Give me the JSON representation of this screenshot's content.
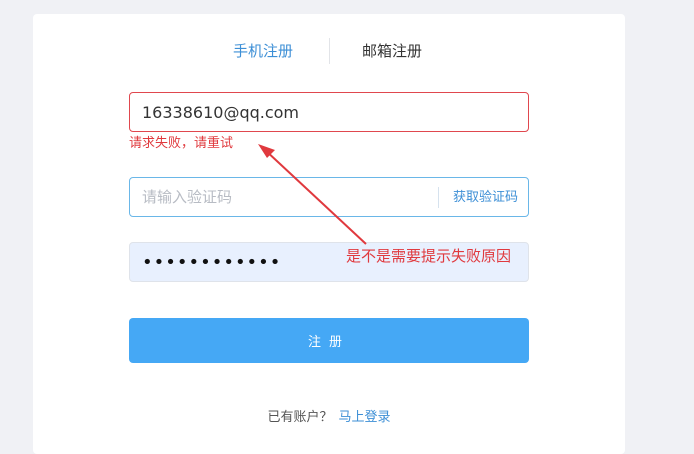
{
  "tabs": {
    "phone_label": "手机注册",
    "email_label": "邮箱注册"
  },
  "form": {
    "email_value": "16338610@qq.com",
    "error_message": "请求失败，请重试",
    "code_placeholder": "请输入验证码",
    "get_code_label": "获取验证码",
    "password_value": "••••••••••••",
    "submit_label": "注册"
  },
  "footer": {
    "has_account_text": "已有账户？",
    "login_link_label": "马上登录"
  },
  "annotation": {
    "text": "是不是需要提示失败原因",
    "color": "#e0393e"
  },
  "colors": {
    "accent": "#3d8fd6",
    "button": "#45a8f5",
    "error": "#e0474e"
  }
}
